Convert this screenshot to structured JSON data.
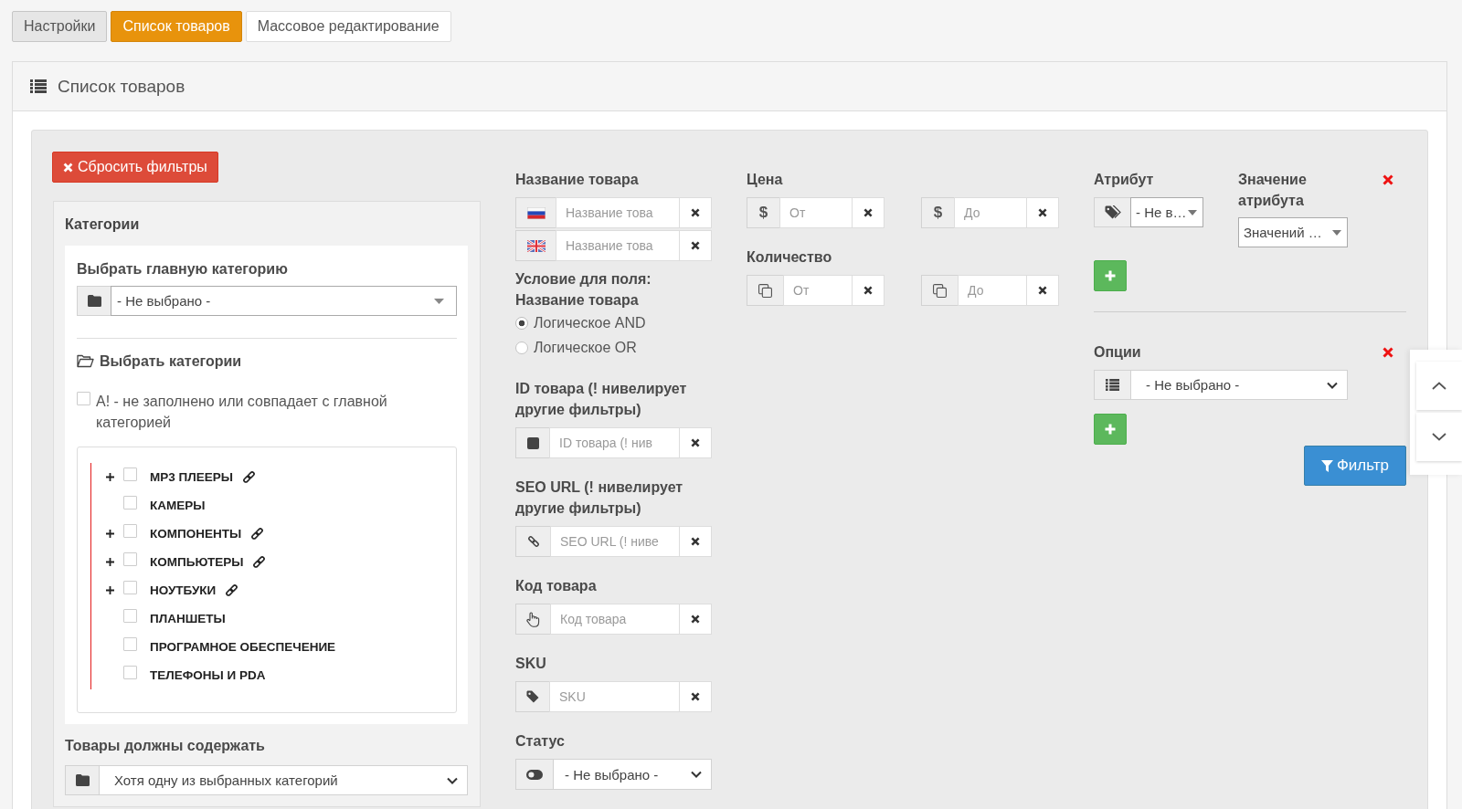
{
  "tabs": [
    {
      "label": "Настройки",
      "kind": "filled",
      "selected": false
    },
    {
      "label": "Список товаров",
      "kind": "filled",
      "selected": true
    },
    {
      "label": "Массовое редактирование",
      "kind": "outline",
      "selected": false
    }
  ],
  "panel": {
    "title": "Список товаров"
  },
  "filters": {
    "reset_button": {
      "label": "Сбросить фильтры"
    },
    "categories": {
      "title": "Категории",
      "main_category": {
        "label": "Выбрать главную категорию",
        "value": "- Не выбрано -"
      },
      "select_heading": "Выбрать категории",
      "unfilled_option": {
        "label": "А! - не заполнено или совпадает с главной категорией",
        "checked": false
      },
      "tree": [
        {
          "label": "MP3 ПЛЕЕРЫ",
          "expandable": true,
          "checked": false,
          "linked": true
        },
        {
          "label": "КАМЕРЫ",
          "expandable": false,
          "checked": false,
          "linked": false
        },
        {
          "label": "КОМПОНЕНТЫ",
          "expandable": true,
          "checked": false,
          "linked": true
        },
        {
          "label": "КОМПЬЮТЕРЫ",
          "expandable": true,
          "checked": false,
          "linked": true
        },
        {
          "label": "НОУТБУКИ",
          "expandable": true,
          "checked": false,
          "linked": true
        },
        {
          "label": "ПЛАНШЕТЫ",
          "expandable": false,
          "checked": false,
          "linked": false
        },
        {
          "label": "ПРОГРАМНОЕ ОБЕСПЕЧЕНИЕ",
          "expandable": false,
          "checked": false,
          "linked": false
        },
        {
          "label": "ТЕЛЕФОНЫ И PDA",
          "expandable": false,
          "checked": false,
          "linked": false
        }
      ],
      "must_contain": {
        "label": "Товары должны содержать",
        "value": "Хотя одну из выбранных категорий"
      }
    },
    "product_name": {
      "label": "Название товара",
      "fields": [
        {
          "kind": "ru",
          "placeholder": "Название това"
        },
        {
          "kind": "gb",
          "placeholder": "Название това"
        }
      ]
    },
    "name_condition": {
      "label": "Условие для поля: Название товара",
      "options": [
        {
          "label": "Логическое AND",
          "selected": true
        },
        {
          "label": "Логическое OR",
          "selected": false
        }
      ]
    },
    "product_id": {
      "label": "ID товара (! нивелирует другие фильтры)",
      "placeholder": "ID товара (! нив"
    },
    "seo_url": {
      "label": "SEO URL (! нивелирует другие фильтры)",
      "placeholder": "SEO URL (! ниве"
    },
    "product_code": {
      "label": "Код товара",
      "placeholder": "Код товара"
    },
    "sku": {
      "label": "SKU",
      "placeholder": "SKU"
    },
    "status": {
      "label": "Статус",
      "value": "- Не выбрано -"
    },
    "price": {
      "label": "Цена",
      "from": {
        "symbol": "$",
        "placeholder": "От"
      },
      "to": {
        "symbol": "$",
        "placeholder": "До"
      }
    },
    "quantity": {
      "label": "Количество",
      "from": {
        "placeholder": "От"
      },
      "to": {
        "placeholder": "До"
      }
    },
    "attribute": {
      "label": "Атрибут",
      "value": "- Не в…"
    },
    "attribute_value": {
      "label": "Значение атрибута",
      "value": "Значений …"
    },
    "options": {
      "label": "Опции",
      "value": "- Не выбрано -"
    },
    "filter_button": {
      "label": "Фильтр"
    }
  }
}
